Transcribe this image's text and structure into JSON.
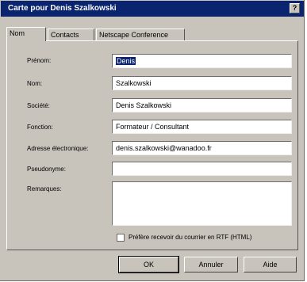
{
  "window": {
    "title": "Carte pour Denis Szalkowski",
    "help_glyph": "?"
  },
  "tabs": [
    {
      "label": "Nom"
    },
    {
      "label": "Contacts"
    },
    {
      "label": "Netscape Conference"
    }
  ],
  "fields": {
    "prenom": {
      "label": "Prénom:",
      "value": "Denis"
    },
    "nom": {
      "label": "Nom:",
      "value": "Szalkowski"
    },
    "societe": {
      "label": "Société:",
      "value": "Denis Szalkowski"
    },
    "fonction": {
      "label": "Fonction:",
      "value": "Formateur / Consultant"
    },
    "email": {
      "label": "Adresse électronique:",
      "value": "denis.szalkowski@wanadoo.fr"
    },
    "pseudonyme": {
      "label": "Pseudonyme:",
      "value": ""
    },
    "remarques": {
      "label": "Remarques:",
      "value": ""
    }
  },
  "checkbox": {
    "label": "Préfère recevoir du courrier en RTF (HTML)",
    "checked": false
  },
  "buttons": {
    "ok": "OK",
    "cancel": "Annuler",
    "help": "Aide"
  }
}
